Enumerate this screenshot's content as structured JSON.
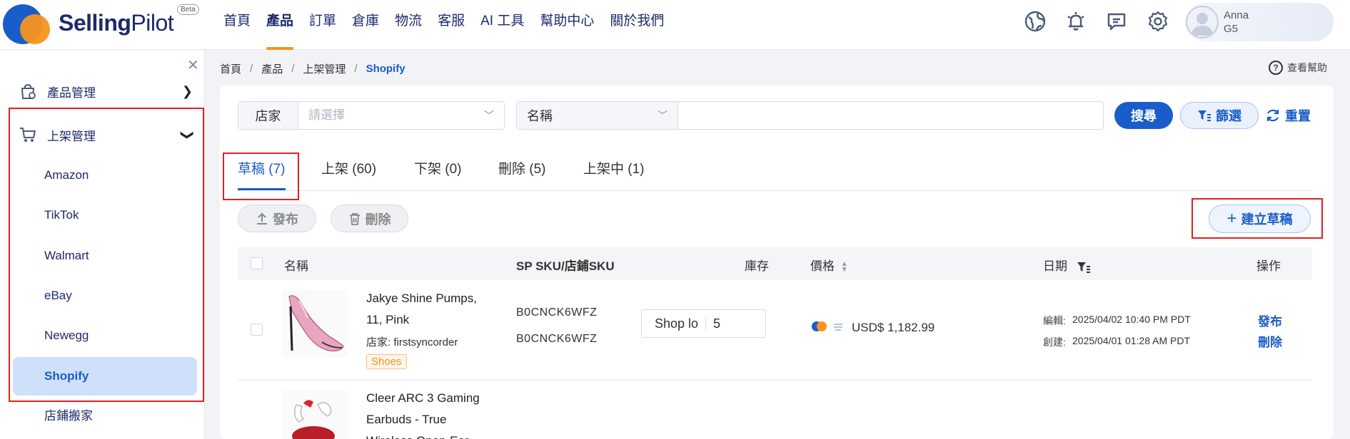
{
  "header": {
    "logo_bold": "Selling",
    "logo_light": "Pilot",
    "beta": "Beta",
    "nav": [
      "首頁",
      "產品",
      "訂單",
      "倉庫",
      "物流",
      "客服",
      "AI 工具",
      "幫助中心",
      "關於我們"
    ],
    "user_name": "Anna",
    "user_sub": "G5"
  },
  "sidebar": {
    "product_mgmt": "產品管理",
    "listing_mgmt": "上架管理",
    "sub_items": [
      "Amazon",
      "TikTok",
      "Walmart",
      "eBay",
      "Newegg",
      "Shopify",
      "店鋪搬家"
    ]
  },
  "breadcrumb": [
    "首頁",
    "產品",
    "上架管理",
    "Shopify"
  ],
  "help": "查看幫助",
  "filters": {
    "store_label": "店家",
    "store_placeholder": "請選擇",
    "name_label": "名稱",
    "search": "搜尋",
    "filter": "篩選",
    "reset": "重置"
  },
  "tabs": [
    "草稿 (7)",
    "上架 (60)",
    "下架 (0)",
    "刪除 (5)",
    "上架中 (1)"
  ],
  "actions": {
    "publish": "發布",
    "delete": "刪除",
    "create_draft": "建立草稿"
  },
  "table": {
    "headers": {
      "name": "名稱",
      "sku": "SP SKU/店鋪SKU",
      "stock": "庫存",
      "price": "價格",
      "date": "日期",
      "ops": "操作"
    },
    "rows": [
      {
        "title_line1": "Jakye Shine Pumps,",
        "title_line2": "11, Pink",
        "store": "店家: firstsyncorder",
        "tag": "Shoes",
        "sp_sku": "B0CNCK6WFZ",
        "store_sku": "B0CNCK6WFZ",
        "stock_label": "Shop lo",
        "stock_qty": "5",
        "price": "USD$ 1,182.99",
        "edited_label": "編輯:",
        "edited": "2025/04/02 10:40 PM PDT",
        "created_label": "創建:",
        "created": "2025/04/01 01:28 AM PDT",
        "op1": "發布",
        "op2": "刪除"
      },
      {
        "title_line1": "Cleer ARC 3 Gaming",
        "title_line2": "Earbuds - True",
        "title_line3": "Wireless Open-Ear"
      }
    ]
  }
}
